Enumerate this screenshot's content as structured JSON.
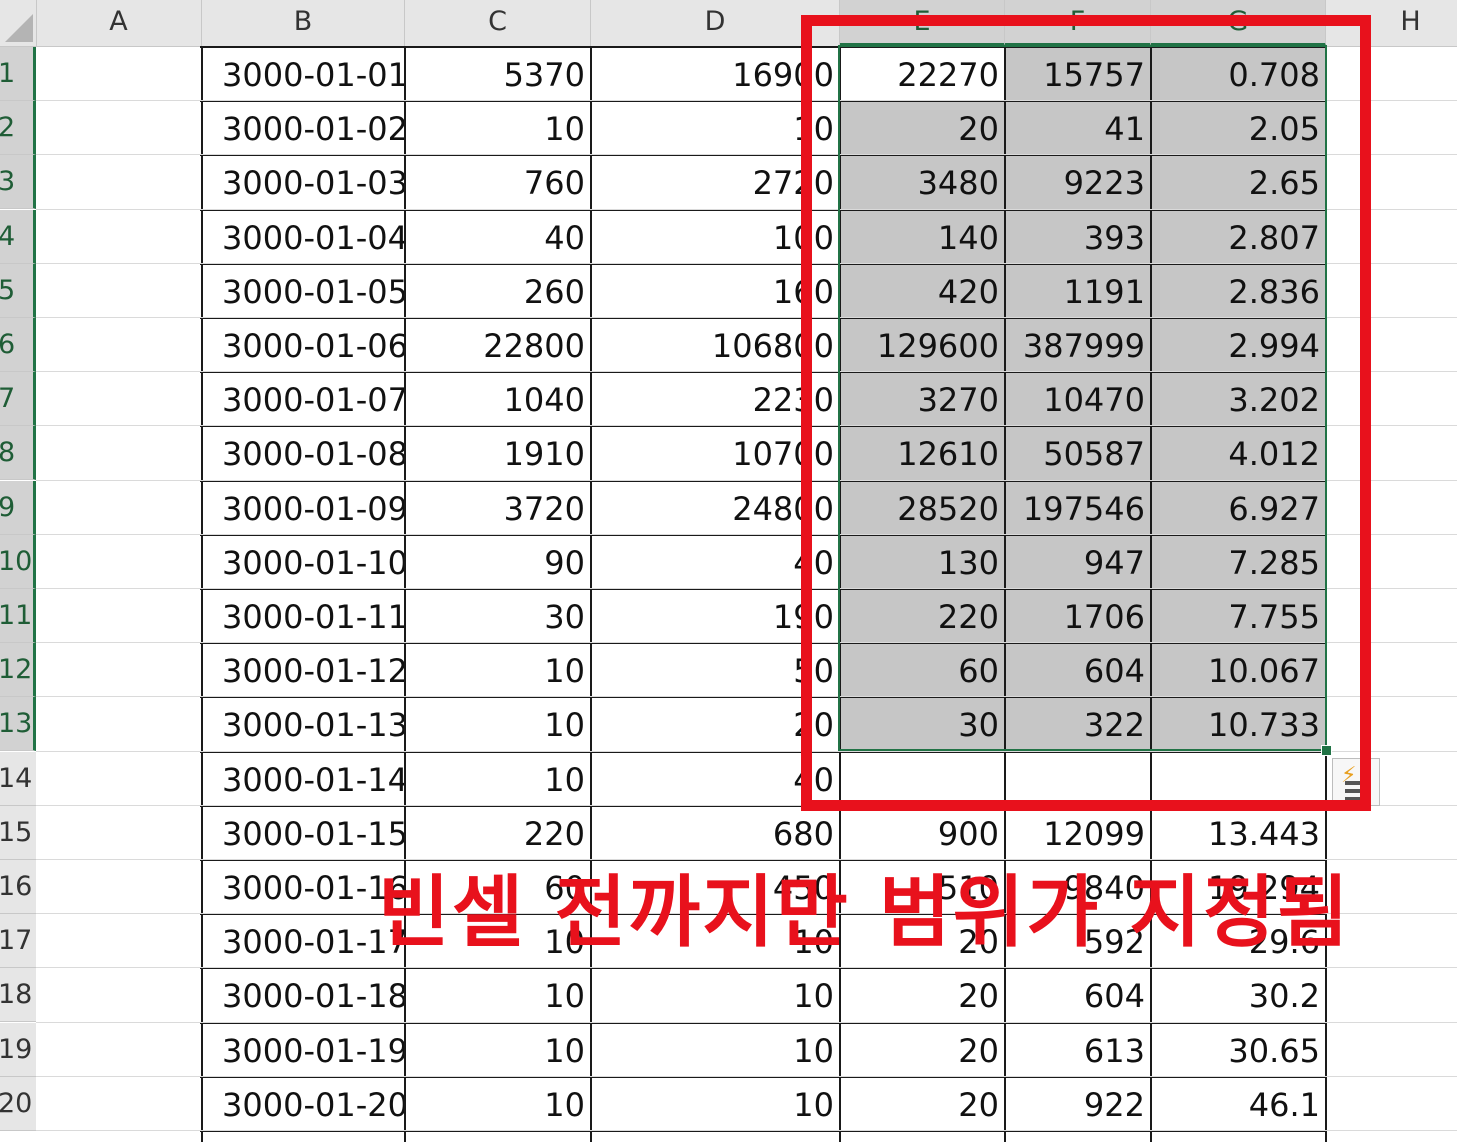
{
  "columns": [
    "A",
    "B",
    "C",
    "D",
    "E",
    "F",
    "G",
    "H"
  ],
  "rows": [
    {
      "num": "1",
      "date": "3000-01-01",
      "c": "5370",
      "d": "16900",
      "e": "22270",
      "f": "15757",
      "g": "0.708"
    },
    {
      "num": "2",
      "date": "3000-01-02",
      "c": "10",
      "d": "10",
      "e": "20",
      "f": "41",
      "g": "2.05"
    },
    {
      "num": "3",
      "date": "3000-01-03",
      "c": "760",
      "d": "2720",
      "e": "3480",
      "f": "9223",
      "g": "2.65"
    },
    {
      "num": "4",
      "date": "3000-01-04",
      "c": "40",
      "d": "100",
      "e": "140",
      "f": "393",
      "g": "2.807"
    },
    {
      "num": "5",
      "date": "3000-01-05",
      "c": "260",
      "d": "160",
      "e": "420",
      "f": "1191",
      "g": "2.836"
    },
    {
      "num": "6",
      "date": "3000-01-06",
      "c": "22800",
      "d": "106800",
      "e": "129600",
      "f": "387999",
      "g": "2.994"
    },
    {
      "num": "7",
      "date": "3000-01-07",
      "c": "1040",
      "d": "2230",
      "e": "3270",
      "f": "10470",
      "g": "3.202"
    },
    {
      "num": "8",
      "date": "3000-01-08",
      "c": "1910",
      "d": "10700",
      "e": "12610",
      "f": "50587",
      "g": "4.012"
    },
    {
      "num": "9",
      "date": "3000-01-09",
      "c": "3720",
      "d": "24800",
      "e": "28520",
      "f": "197546",
      "g": "6.927"
    },
    {
      "num": "10",
      "date": "3000-01-10",
      "c": "90",
      "d": "40",
      "e": "130",
      "f": "947",
      "g": "7.285"
    },
    {
      "num": "11",
      "date": "3000-01-11",
      "c": "30",
      "d": "190",
      "e": "220",
      "f": "1706",
      "g": "7.755"
    },
    {
      "num": "12",
      "date": "3000-01-12",
      "c": "10",
      "d": "50",
      "e": "60",
      "f": "604",
      "g": "10.067"
    },
    {
      "num": "13",
      "date": "3000-01-13",
      "c": "10",
      "d": "20",
      "e": "30",
      "f": "322",
      "g": "10.733"
    },
    {
      "num": "14",
      "date": "3000-01-14",
      "c": "10",
      "d": "40",
      "e": "",
      "f": "",
      "g": ""
    },
    {
      "num": "15",
      "date": "3000-01-15",
      "c": "220",
      "d": "680",
      "e": "900",
      "f": "12099",
      "g": "13.443"
    },
    {
      "num": "16",
      "date": "3000-01-16",
      "c": "60",
      "d": "450",
      "e": "510",
      "f": "9840",
      "g": "19.294"
    },
    {
      "num": "17",
      "date": "3000-01-17",
      "c": "10",
      "d": "10",
      "e": "20",
      "f": "592",
      "g": "29.6"
    },
    {
      "num": "18",
      "date": "3000-01-18",
      "c": "10",
      "d": "10",
      "e": "20",
      "f": "604",
      "g": "30.2"
    },
    {
      "num": "19",
      "date": "3000-01-19",
      "c": "10",
      "d": "10",
      "e": "20",
      "f": "613",
      "g": "30.65"
    },
    {
      "num": "20",
      "date": "3000-01-20",
      "c": "10",
      "d": "10",
      "e": "20",
      "f": "922",
      "g": "46.1"
    }
  ],
  "annotation": {
    "caption": "빈셀 전까지만 범위가 지정됨",
    "color": "#e8111c"
  },
  "colors": {
    "selection_border": "#217346",
    "selection_fill": "#c6c6c6",
    "header_bg": "#e6e6e6"
  },
  "icons": {
    "quick_analysis": "quick-analysis-icon"
  }
}
